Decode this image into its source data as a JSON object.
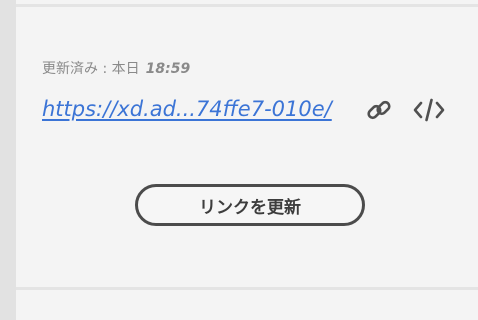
{
  "share": {
    "updated_label": "更新済み : 本日",
    "updated_time": "18:59",
    "link_text": "https://xd.ad...74ffe7-010e/",
    "copy_link_icon": "link-icon",
    "embed_icon": "code-icon",
    "update_link_label": "リンクを更新"
  },
  "colors": {
    "link": "#3b74d6",
    "button_border": "#4b4b4b",
    "muted_text": "#8a8a8a"
  }
}
